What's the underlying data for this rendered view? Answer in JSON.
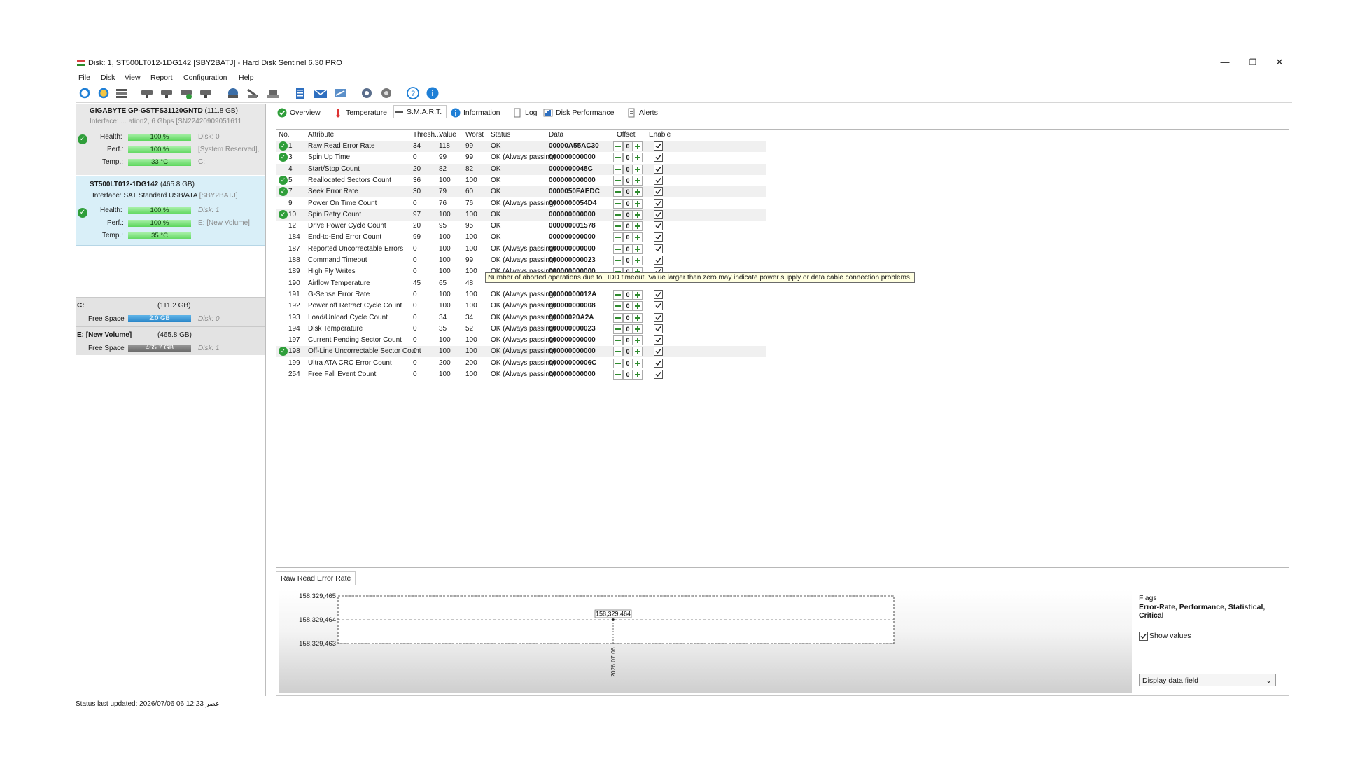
{
  "window": {
    "title": "Disk: 1, ST500LT012-1DG142 [SBY2BATJ]  -  Hard Disk Sentinel 6.30 PRO",
    "controls": {
      "minimize": "—",
      "restore": "❐",
      "close": "✕"
    }
  },
  "menu": [
    "File",
    "Disk",
    "View",
    "Report",
    "Configuration",
    "Help"
  ],
  "toolbar_icons": [
    "refresh-icon",
    "refresh-all-icon",
    "disk-list-icon",
    "drive-icon",
    "drive-icon",
    "drive-check-icon",
    "drive-icon",
    "network-icon",
    "drive-tools-icon",
    "drive-tools-icon",
    "report-icon",
    "mail-icon",
    "send-icon",
    "settings-icon",
    "settings-alt-icon",
    "help-icon",
    "info-icon"
  ],
  "disks": [
    {
      "name": "GIGABYTE GP-GSTFS31120GNTD",
      "size": "(111.8 GB)",
      "interface_line": "Interface: ... ation2, 6 Gbps [SN22420909051611",
      "health_label": "Health:",
      "health": "100 %",
      "health_note": "Disk: 0",
      "perf_label": "Perf.:",
      "perf": "100 %",
      "perf_note": "[System Reserved],",
      "temp_label": "Temp.:",
      "temp": "33 °C",
      "temp_note": "C:"
    },
    {
      "name": "ST500LT012-1DG142",
      "size": "(465.8 GB)",
      "interface_prefix": "Interface: SAT Standard USB/ATA",
      "interface_id": "[SBY2BATJ]",
      "health_label": "Health:",
      "health": "100 %",
      "health_note": "Disk: 1",
      "health_value": 100,
      "perf_label": "Perf.:",
      "perf": "100 %",
      "perf_note": "E: [New Volume]",
      "perf_value": 100,
      "temp_label": "Temp.:",
      "temp": "35 °C"
    }
  ],
  "volumes": [
    {
      "name": "C:",
      "size": "(111.2 GB)",
      "free_label": "Free Space",
      "free": "2.0 GB",
      "disk": "Disk: 0"
    },
    {
      "name": "E: [New Volume]",
      "size": "(465.8 GB)",
      "free_label": "Free Space",
      "free": "465.7 GB",
      "disk": "Disk: 1"
    }
  ],
  "tabs": [
    "Overview",
    "Temperature",
    "S.M.A.R.T.",
    "Information",
    "Log",
    "Disk Performance",
    "Alerts"
  ],
  "active_tab": "S.M.A.R.T.",
  "columns": [
    "No.",
    "Attribute",
    "Thresh...",
    "Value",
    "Worst",
    "Status",
    "Data",
    "Offset",
    "Enable"
  ],
  "smart_rows": [
    {
      "no": "1",
      "attr": "Raw Read Error Rate",
      "thr": "34",
      "val": "118",
      "worst": "99",
      "status": "OK",
      "data": "00000A55AC30",
      "offset": "0",
      "icon": true,
      "shade": true
    },
    {
      "no": "3",
      "attr": "Spin Up Time",
      "thr": "0",
      "val": "99",
      "worst": "99",
      "status": "OK (Always passing)",
      "data": "000000000000",
      "offset": "0",
      "icon": true,
      "shade": false
    },
    {
      "no": "4",
      "attr": "Start/Stop Count",
      "thr": "20",
      "val": "82",
      "worst": "82",
      "status": "OK",
      "data": "0000000048C",
      "offset": "0",
      "icon": false,
      "shade": true
    },
    {
      "no": "5",
      "attr": "Reallocated Sectors Count",
      "thr": "36",
      "val": "100",
      "worst": "100",
      "status": "OK",
      "data": "000000000000",
      "offset": "0",
      "icon": true,
      "shade": false
    },
    {
      "no": "7",
      "attr": "Seek Error Rate",
      "thr": "30",
      "val": "79",
      "worst": "60",
      "status": "OK",
      "data": "0000050FAEDC",
      "offset": "0",
      "icon": true,
      "shade": true
    },
    {
      "no": "9",
      "attr": "Power On Time Count",
      "thr": "0",
      "val": "76",
      "worst": "76",
      "status": "OK (Always passing)",
      "data": "0000000054D4",
      "offset": "0",
      "icon": false,
      "shade": false
    },
    {
      "no": "10",
      "attr": "Spin Retry Count",
      "thr": "97",
      "val": "100",
      "worst": "100",
      "status": "OK",
      "data": "000000000000",
      "offset": "0",
      "icon": true,
      "shade": true
    },
    {
      "no": "12",
      "attr": "Drive Power Cycle Count",
      "thr": "20",
      "val": "95",
      "worst": "95",
      "status": "OK",
      "data": "000000001578",
      "offset": "0",
      "icon": false,
      "shade": false
    },
    {
      "no": "184",
      "attr": "End-to-End Error Count",
      "thr": "99",
      "val": "100",
      "worst": "100",
      "status": "OK",
      "data": "000000000000",
      "offset": "0",
      "icon": false,
      "shade": false
    },
    {
      "no": "187",
      "attr": "Reported Uncorrectable Errors",
      "thr": "0",
      "val": "100",
      "worst": "100",
      "status": "OK (Always passing)",
      "data": "000000000000",
      "offset": "0",
      "icon": false,
      "shade": false
    },
    {
      "no": "188",
      "attr": "Command Timeout",
      "thr": "0",
      "val": "100",
      "worst": "99",
      "status": "OK (Always passing)",
      "data": "000000000023",
      "offset": "0",
      "icon": false,
      "shade": false
    },
    {
      "no": "189",
      "attr": "High Fly Writes",
      "thr": "0",
      "val": "100",
      "worst": "100",
      "status": "OK (Always passing)",
      "data": "000000000000",
      "offset": "0",
      "icon": false,
      "shade": false
    },
    {
      "no": "190",
      "attr": "Airflow Temperature",
      "thr": "45",
      "val": "65",
      "worst": "48",
      "status": "",
      "data": "",
      "offset": "",
      "icon": false,
      "shade": false
    },
    {
      "no": "191",
      "attr": "G-Sense Error Rate",
      "thr": "0",
      "val": "100",
      "worst": "100",
      "status": "OK (Always passing)",
      "data": "00000000012A",
      "offset": "0",
      "icon": false,
      "shade": false
    },
    {
      "no": "192",
      "attr": "Power off Retract Cycle Count",
      "thr": "0",
      "val": "100",
      "worst": "100",
      "status": "OK (Always passing)",
      "data": "000000000008",
      "offset": "0",
      "icon": false,
      "shade": false
    },
    {
      "no": "193",
      "attr": "Load/Unload Cycle Count",
      "thr": "0",
      "val": "34",
      "worst": "34",
      "status": "OK (Always passing)",
      "data": "00000020A2A",
      "offset": "0",
      "icon": false,
      "shade": false
    },
    {
      "no": "194",
      "attr": "Disk Temperature",
      "thr": "0",
      "val": "35",
      "worst": "52",
      "status": "OK (Always passing)",
      "data": "000000000023",
      "offset": "0",
      "icon": false,
      "shade": false
    },
    {
      "no": "197",
      "attr": "Current Pending Sector Count",
      "thr": "0",
      "val": "100",
      "worst": "100",
      "status": "OK (Always passing)",
      "data": "000000000000",
      "offset": "0",
      "icon": false,
      "shade": false
    },
    {
      "no": "198",
      "attr": "Off-Line Uncorrectable Sector Count",
      "thr": "0",
      "val": "100",
      "worst": "100",
      "status": "OK (Always passing)",
      "data": "000000000000",
      "offset": "0",
      "icon": true,
      "shade": true
    },
    {
      "no": "199",
      "attr": "Ultra ATA CRC Error Count",
      "thr": "0",
      "val": "200",
      "worst": "200",
      "status": "OK (Always passing)",
      "data": "00000000006C",
      "offset": "0",
      "icon": false,
      "shade": false
    },
    {
      "no": "254",
      "attr": "Free Fall Event Count",
      "thr": "0",
      "val": "100",
      "worst": "100",
      "status": "OK (Always passing)",
      "data": "000000000000",
      "offset": "0",
      "icon": false,
      "shade": false
    }
  ],
  "tooltip": "Number of aborted operations due to HDD timeout. Value larger than zero may indicate power supply or data cable connection problems.",
  "graph": {
    "tab_label": "Raw Read Error Rate",
    "flags_title": "Flags",
    "flags_value": "Error-Rate, Performance, Statistical, Critical",
    "show_values_label": "Show values",
    "show_values_checked": true,
    "dropdown_value": "Display data field"
  },
  "chart_data": {
    "type": "line",
    "title": "Raw Read Error Rate",
    "y_ticks": [
      "158,329,465",
      "158,329,464",
      "158,329,463"
    ],
    "ylim": [
      158329463,
      158329465
    ],
    "x": [
      "2026.07.06"
    ],
    "series": [
      {
        "values": [
          158329464
        ]
      }
    ],
    "point_label": "158,329,464",
    "grid": true
  },
  "status_bar": "Status last updated: 2026/07/06 06:12:23 عصر"
}
